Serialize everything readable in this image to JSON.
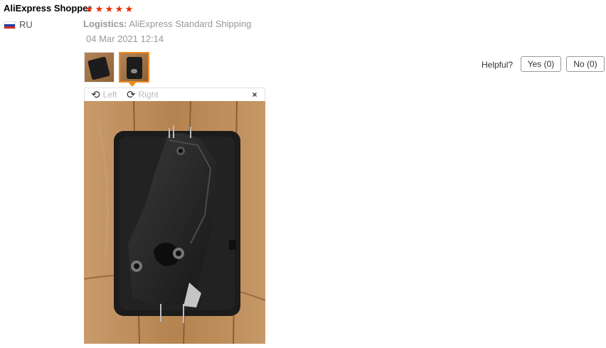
{
  "review": {
    "author": "AliExpress Shopper",
    "rating": 5,
    "rating_max": 5,
    "country": "RU",
    "logistics_label": "Logistics:",
    "logistics_value": "AliExpress Standard Shipping",
    "date": "04 Mar 2021 12:14"
  },
  "helpful": {
    "label": "Helpful?",
    "yes": "Yes (0)",
    "no": "No (0)"
  },
  "viewer": {
    "rotate_left": "Left",
    "rotate_right": "Right",
    "close": "×",
    "thumbnail_count": 2,
    "selected_thumbnail": 2
  },
  "colors": {
    "star": "#e62e04",
    "selected_border": "#f08b1f",
    "muted_text": "#999999"
  },
  "icons": {
    "rotate_left": "rotate-left-icon",
    "rotate_right": "rotate-right-icon",
    "close": "close-icon",
    "star": "star-icon",
    "flag": "russia-flag-icon"
  }
}
